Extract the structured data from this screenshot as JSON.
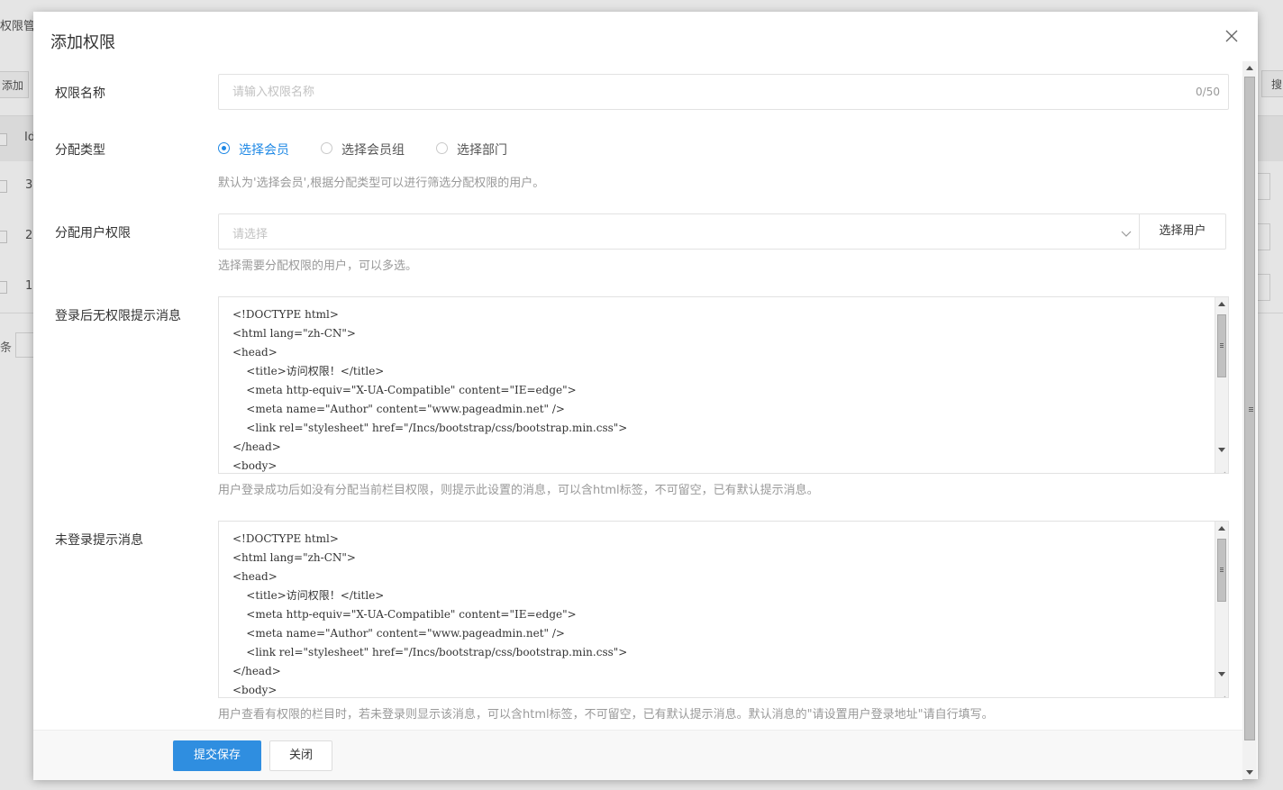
{
  "background": {
    "breadcrumb": "权限管",
    "add_button": "添加",
    "search_button": "搜",
    "table_header_id": "Id",
    "rows": [
      "3",
      "2",
      "1"
    ],
    "pager_text": "条"
  },
  "modal": {
    "title": "添加权限",
    "close_icon": "close-icon",
    "name_field": {
      "label": "权限名称",
      "placeholder": "请输入权限名称",
      "value": "",
      "counter": "0/50"
    },
    "assign_type": {
      "label": "分配类型",
      "options": [
        {
          "label": "选择会员",
          "selected": true
        },
        {
          "label": "选择会员组",
          "selected": false
        },
        {
          "label": "选择部门",
          "selected": false
        }
      ],
      "help": "默认为'选择会员',根据分配类型可以进行筛选分配权限的用户。"
    },
    "assign_users": {
      "label": "分配用户权限",
      "placeholder": "请选择",
      "button": "选择用户",
      "help": "选择需要分配权限的用户，可以多选。"
    },
    "no_permission_message": {
      "label": "登录后无权限提示消息",
      "code": "<!DOCTYPE html>\n<html lang=\"zh-CN\">\n<head>\n    <title>访问权限！</title>\n    <meta http-equiv=\"X-UA-Compatible\" content=\"IE=edge\">\n    <meta name=\"Author\" content=\"www.pageadmin.net\" />\n    <link rel=\"stylesheet\" href=\"/Incs/bootstrap/css/bootstrap.min.css\">\n</head>\n<body>",
      "help": "用户登录成功后如没有分配当前栏目权限，则提示此设置的消息，可以含html标签，不可留空，已有默认提示消息。"
    },
    "not_logged_in_message": {
      "label": "未登录提示消息",
      "code": "<!DOCTYPE html>\n<html lang=\"zh-CN\">\n<head>\n    <title>访问权限！</title>\n    <meta http-equiv=\"X-UA-Compatible\" content=\"IE=edge\">\n    <meta name=\"Author\" content=\"www.pageadmin.net\" />\n    <link rel=\"stylesheet\" href=\"/Incs/bootstrap/css/bootstrap.min.css\">\n</head>\n<body>",
      "help": "用户查看有权限的栏目时，若未登录则显示该消息，可以含html标签，不可留空，已有默认提示消息。默认消息的\"请设置用户登录地址\"请自行填写。"
    },
    "footer": {
      "submit": "提交保存",
      "close": "关闭"
    },
    "colors": {
      "primary": "#2f8ee0",
      "radio_active": "#1e88e5"
    }
  }
}
